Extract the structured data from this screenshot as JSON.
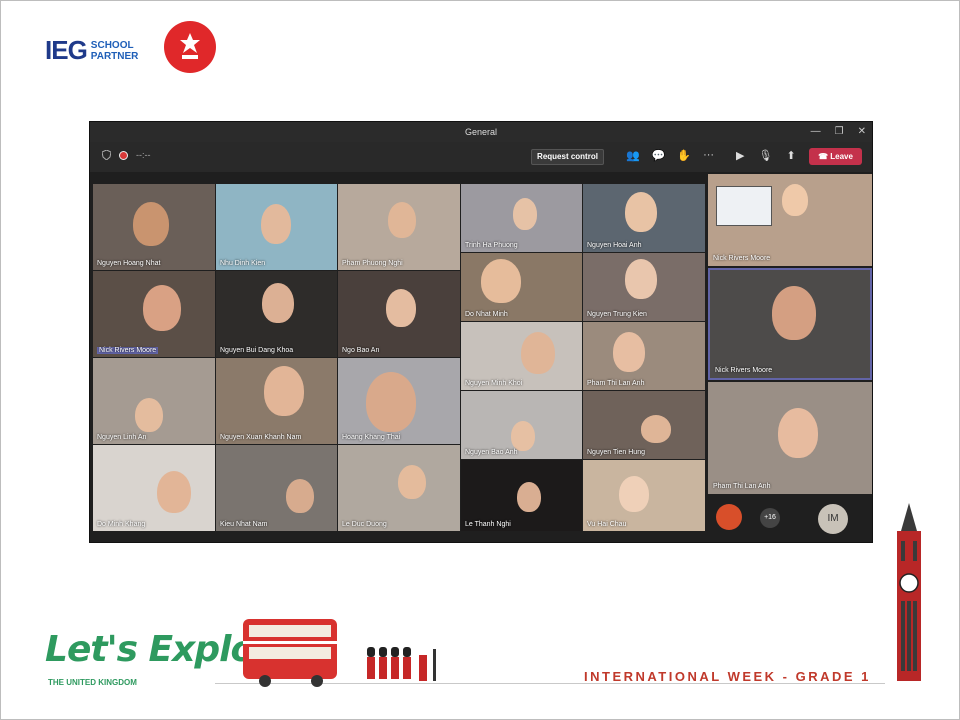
{
  "logos": {
    "ieg_mark": "IEG",
    "ieg_sub1": "SCHOOL",
    "ieg_sub2": "PARTNER"
  },
  "window": {
    "title": "General",
    "timer": "--:--",
    "request_control": "Request control",
    "leave": "Leave"
  },
  "participants": [
    {
      "name": "Nguyen Hoang Nhat"
    },
    {
      "name": "Nhu Dinh Kien"
    },
    {
      "name": "Pham Phuong Nghi"
    },
    {
      "name": "Trinh Ha Phuong"
    },
    {
      "name": "Nguyen Hoai Anh"
    },
    {
      "name": "Nick Rivers Moore"
    },
    {
      "name": "Nguyen Bui Dang Khoa"
    },
    {
      "name": "Ngo Bao An"
    },
    {
      "name": "Do Nhat Minh"
    },
    {
      "name": "Nguyen Trung Kien"
    },
    {
      "name": "Nguyen Minh Khoi"
    },
    {
      "name": "Pham Thi Lan Anh"
    },
    {
      "name": "Nguyen Linh An"
    },
    {
      "name": "Nguyen Xuan Khanh Nam"
    },
    {
      "name": "Hoang Khang Thai"
    },
    {
      "name": "Nguyen Bao Anh"
    },
    {
      "name": "Nguyen Tien Hung"
    },
    {
      "name": "Do Minh Khang"
    },
    {
      "name": "Kieu Nhat Nam"
    },
    {
      "name": "Le Duc Duong"
    },
    {
      "name": "Le Thanh Nghi"
    },
    {
      "name": "Vu Hai Chau"
    }
  ],
  "side_panel": [
    {
      "name": "Nick Rivers Moore"
    },
    {
      "name": "Nick Rivers Moore"
    },
    {
      "name": "Pham Thi Lan Anh"
    }
  ],
  "overflow": {
    "count": "+16",
    "avatar": "IM"
  },
  "footer": {
    "lets_explore": "Let's Explore",
    "subtitle": "THE UNITED KINGDOM",
    "banner": "INTERNATIONAL WEEK - GRADE 1"
  },
  "icons": {
    "shield": "shield-icon",
    "record": "record-icon",
    "people": "people-icon",
    "chat": "chat-icon",
    "reactions": "reactions-icon",
    "more": "more-icon",
    "camera": "camera-icon",
    "mic": "mic-icon",
    "share": "share-icon",
    "phone": "phone-icon"
  }
}
